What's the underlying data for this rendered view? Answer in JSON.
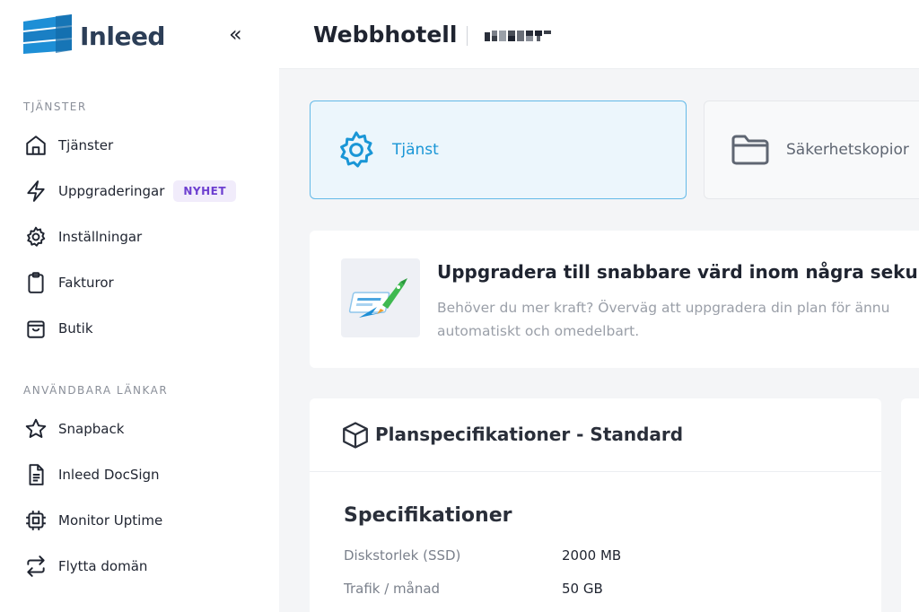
{
  "brand": {
    "name": "Inleed",
    "logo_color": "#1e8fd6"
  },
  "sidebar": {
    "collapse_label": "«",
    "sections": [
      {
        "label": "TJÄNSTER"
      },
      {
        "label": "ANVÄNDBARA LÄNKAR"
      }
    ],
    "items": [
      {
        "label": "Tjänster",
        "icon": "home-icon"
      },
      {
        "label": "Uppgraderingar",
        "icon": "lightning-icon",
        "badge": "NYHET"
      },
      {
        "label": "Inställningar",
        "icon": "gear-icon"
      },
      {
        "label": "Fakturor",
        "icon": "clipboard-icon"
      },
      {
        "label": "Butik",
        "icon": "shopping-bag-icon"
      }
    ],
    "links": [
      {
        "label": "Snapback",
        "icon": "star-icon"
      },
      {
        "label": "Inleed DocSign",
        "icon": "document-icon"
      },
      {
        "label": "Monitor Uptime",
        "icon": "chip-icon"
      },
      {
        "label": "Flytta domän",
        "icon": "arrows-swap-icon"
      }
    ]
  },
  "header": {
    "title": "Webbhotell"
  },
  "tabs": [
    {
      "label": "Tjänst",
      "icon": "gear-icon",
      "active": true
    },
    {
      "label": "Säkerhetskopior",
      "icon": "folder-icon",
      "active": false
    }
  ],
  "promo": {
    "title": "Uppgradera till snabbare värd inom några sekunder",
    "description_line1": "Behöver du mer kraft? Överväg att uppgradera din plan för ännu",
    "description_line2": "automatiskt och omedelbart.",
    "image_icon": "rocket-icon"
  },
  "plan": {
    "title": "Planspecifikationer - Standard",
    "icon": "box-icon",
    "subtitle": "Specifikationer",
    "rows": [
      {
        "key": "Diskstorlek (SSD)",
        "value": "2000 MB"
      },
      {
        "key": "Trafik / månad",
        "value": "50 GB"
      }
    ]
  },
  "colors": {
    "accent": "#1a96d6",
    "badge_text": "#6d3fd0",
    "badge_bg": "#f1ecfb"
  }
}
